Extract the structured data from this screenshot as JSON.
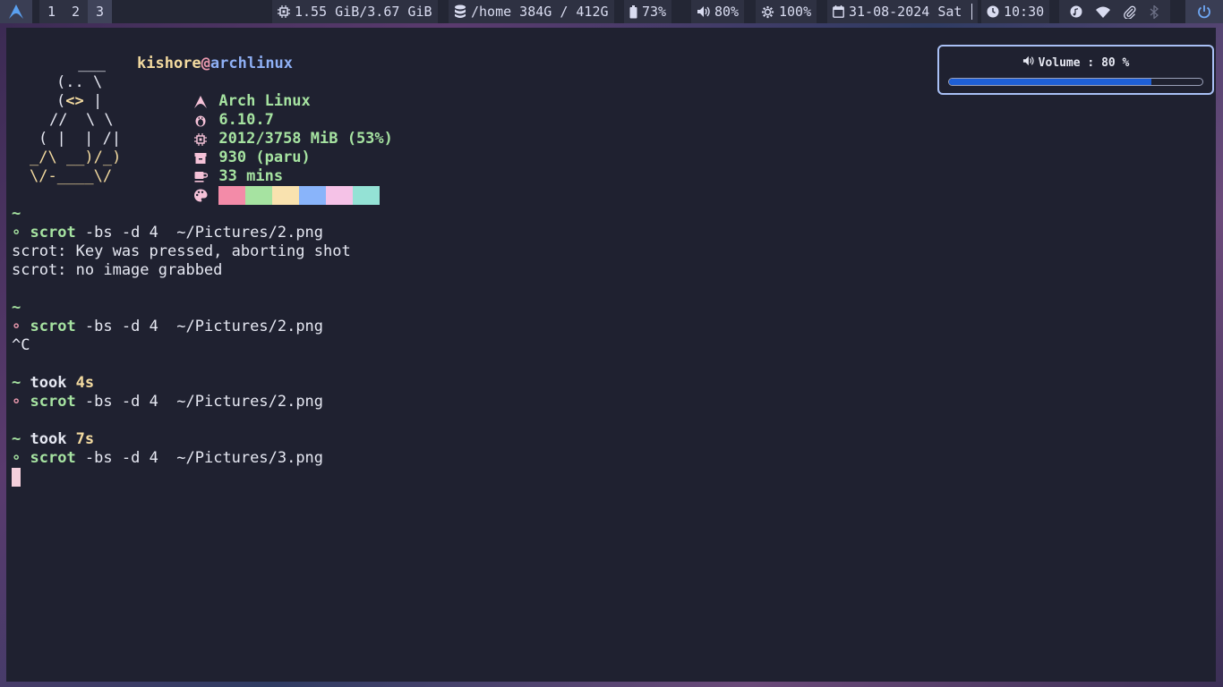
{
  "topbar": {
    "workspaces": [
      "1",
      "2",
      "3"
    ],
    "active_workspace": "3",
    "memory": "1.55 GiB/3.67 GiB",
    "disk": "/home 384G / 412G",
    "battery": "73%",
    "volume": "80%",
    "brightness": "100%",
    "date": "31-08-2024 Sat",
    "time": "10:30",
    "icons": [
      "arch-logo-icon",
      "cpu-icon",
      "database-icon",
      "battery-icon",
      "speaker-icon",
      "gear-icon",
      "calendar-icon",
      "clock-icon",
      "music-icon",
      "wifi-icon",
      "paperclip-icon",
      "bluetooth-icon",
      "power-icon"
    ]
  },
  "terminal": {
    "fastfetch": {
      "ascii": [
        " ___",
        "(.. \\",
        "(<> |",
        "//  \\ \\",
        "( |  | /|",
        "_/\\ __)/_)",
        "\\/-____\\/"
      ],
      "user": "kishore",
      "at": "@",
      "host": "archlinux",
      "os": "Arch Linux",
      "kernel": "6.10.7",
      "memory": "2012/3758 MiB (53%)",
      "packages": "930 (paru)",
      "uptime": "33 mins",
      "palette": [
        "#f38ba8",
        "#a6e3a1",
        "#f9e2af",
        "#89b4fa",
        "#f5c2e7",
        "#94e2d5"
      ]
    },
    "prompt_dir": "~",
    "prompt_symbol": "∘",
    "entries": [
      {
        "took_label": "",
        "took_value": "",
        "command": "scrot",
        "args": " -bs -d 4  ~/Pictures/2.png",
        "output": [
          "scrot: Key was pressed, aborting shot",
          "scrot: no image grabbed"
        ]
      },
      {
        "took_label": "",
        "took_value": "",
        "command": "scrot",
        "args": " -bs -d 4  ~/Pictures/2.png",
        "output": [
          "^C"
        ]
      },
      {
        "took_label": " took ",
        "took_value": "4s",
        "command": "scrot",
        "args": " -bs -d 4  ~/Pictures/2.png",
        "output": []
      },
      {
        "took_label": " took ",
        "took_value": "7s",
        "command": "scrot",
        "args": " -bs -d 4  ~/Pictures/3.png",
        "output": []
      }
    ]
  },
  "osd": {
    "label": "Volume : 80 %",
    "level": 0.8,
    "fill_color": "#1e5fd6",
    "icon": "speaker-icon"
  }
}
